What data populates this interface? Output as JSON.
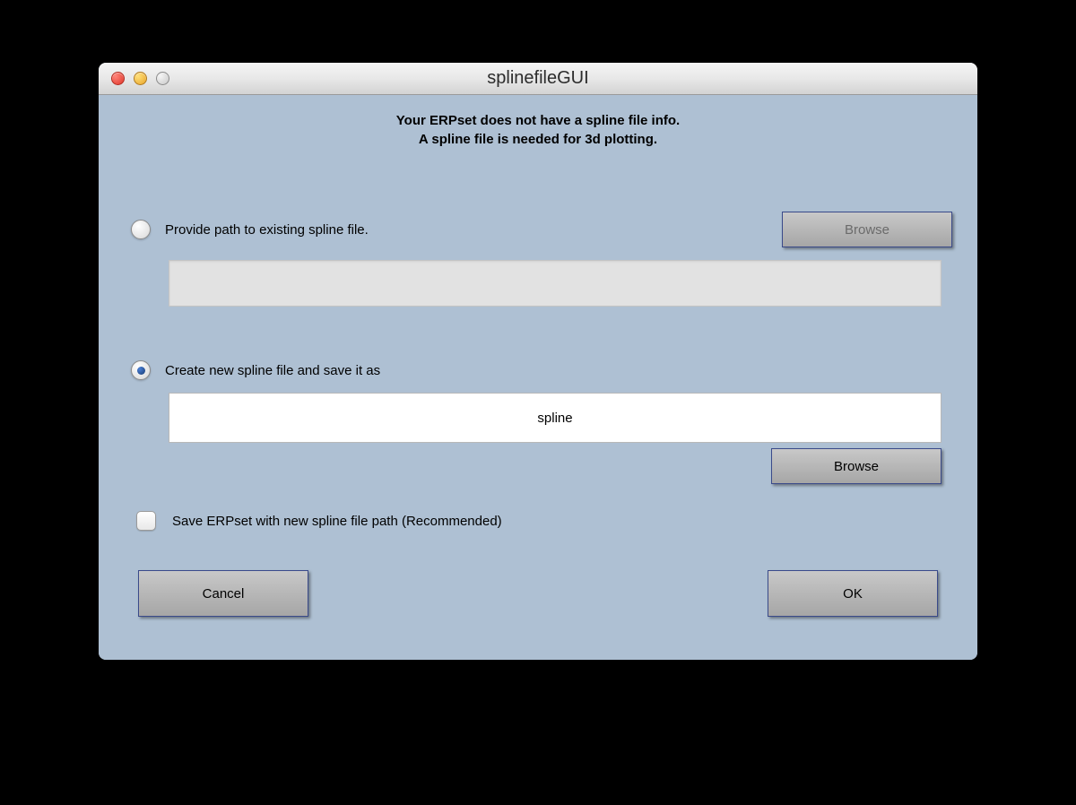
{
  "window": {
    "title": "splinefileGUI"
  },
  "heading": {
    "line1": "Your ERPset does not have a spline file info.",
    "line2": "A spline file is needed for 3d plotting."
  },
  "option1": {
    "label": "Provide path to existing spline file.",
    "selected": false,
    "browse_label": "Browse",
    "path_value": ""
  },
  "option2": {
    "label": "Create new spline file and save it as",
    "selected": true,
    "filename_value": "spline",
    "browse_label": "Browse"
  },
  "save_checkbox": {
    "label": "Save ERPset with new spline file path (Recommended)",
    "checked": false
  },
  "footer": {
    "cancel_label": "Cancel",
    "ok_label": "OK"
  }
}
